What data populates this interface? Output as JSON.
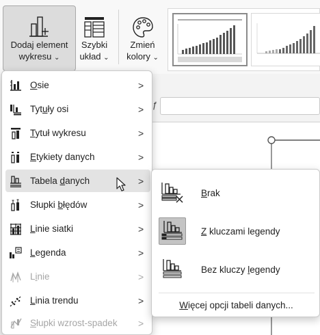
{
  "ribbon": {
    "add_element_line1": "Dodaj element",
    "add_element_line2": "wykresu",
    "quick_layout_line1": "Szybki",
    "quick_layout_line2": "układ",
    "change_colors_line1": "Zmień",
    "change_colors_line2": "kolory",
    "chevron": "⌄"
  },
  "formula_bar": {
    "fx": "ƒ"
  },
  "menu": {
    "items": [
      {
        "pre": "",
        "u": "O",
        "post": "sie",
        "icon": "axes-icon",
        "disabled": false
      },
      {
        "pre": "Tyt",
        "u": "u",
        "post": "ły osi",
        "icon": "axis-titles-icon",
        "disabled": false
      },
      {
        "pre": "",
        "u": "T",
        "post": "ytuł wykresu",
        "icon": "chart-title-icon",
        "disabled": false
      },
      {
        "pre": "",
        "u": "E",
        "post": "tykiety danych",
        "icon": "data-labels-icon",
        "disabled": false
      },
      {
        "pre": "Tabela ",
        "u": "d",
        "post": "anych",
        "icon": "data-table-icon",
        "disabled": false
      },
      {
        "pre": "Słupki ",
        "u": "b",
        "post": "łędów",
        "icon": "error-bars-icon",
        "disabled": false
      },
      {
        "pre": "",
        "u": "L",
        "post": "inie siatki",
        "icon": "gridlines-icon",
        "disabled": false
      },
      {
        "pre": "",
        "u": "L",
        "post": "egenda",
        "icon": "legend-icon",
        "disabled": false
      },
      {
        "pre": "L",
        "u": "i",
        "post": "nie",
        "icon": "lines-icon",
        "disabled": true
      },
      {
        "pre": "",
        "u": "L",
        "post": "inia trendu",
        "icon": "trendline-icon",
        "disabled": false
      },
      {
        "pre": "",
        "u": "S",
        "post": "łupki wzrost-spadek",
        "icon": "up-down-bars-icon",
        "disabled": true
      }
    ],
    "arrow": ">"
  },
  "submenu": {
    "items": [
      {
        "pre": "",
        "u": "B",
        "post": "rak",
        "icon": "no-data-table-icon"
      },
      {
        "pre": "",
        "u": "Z",
        "post": " kluczami legendy",
        "icon": "data-table-with-keys-icon"
      },
      {
        "pre": "Bez kluczy ",
        "u": "l",
        "post": "egendy",
        "icon": "data-table-no-keys-icon"
      }
    ],
    "more": {
      "pre": "",
      "u": "W",
      "post": "ięcej opcji tabeli danych..."
    }
  },
  "colors": {
    "accent_selected_bg": "#e3e3e3",
    "button_pressed_bg": "#dcdcdc",
    "disabled_text": "#a6a6a6"
  }
}
